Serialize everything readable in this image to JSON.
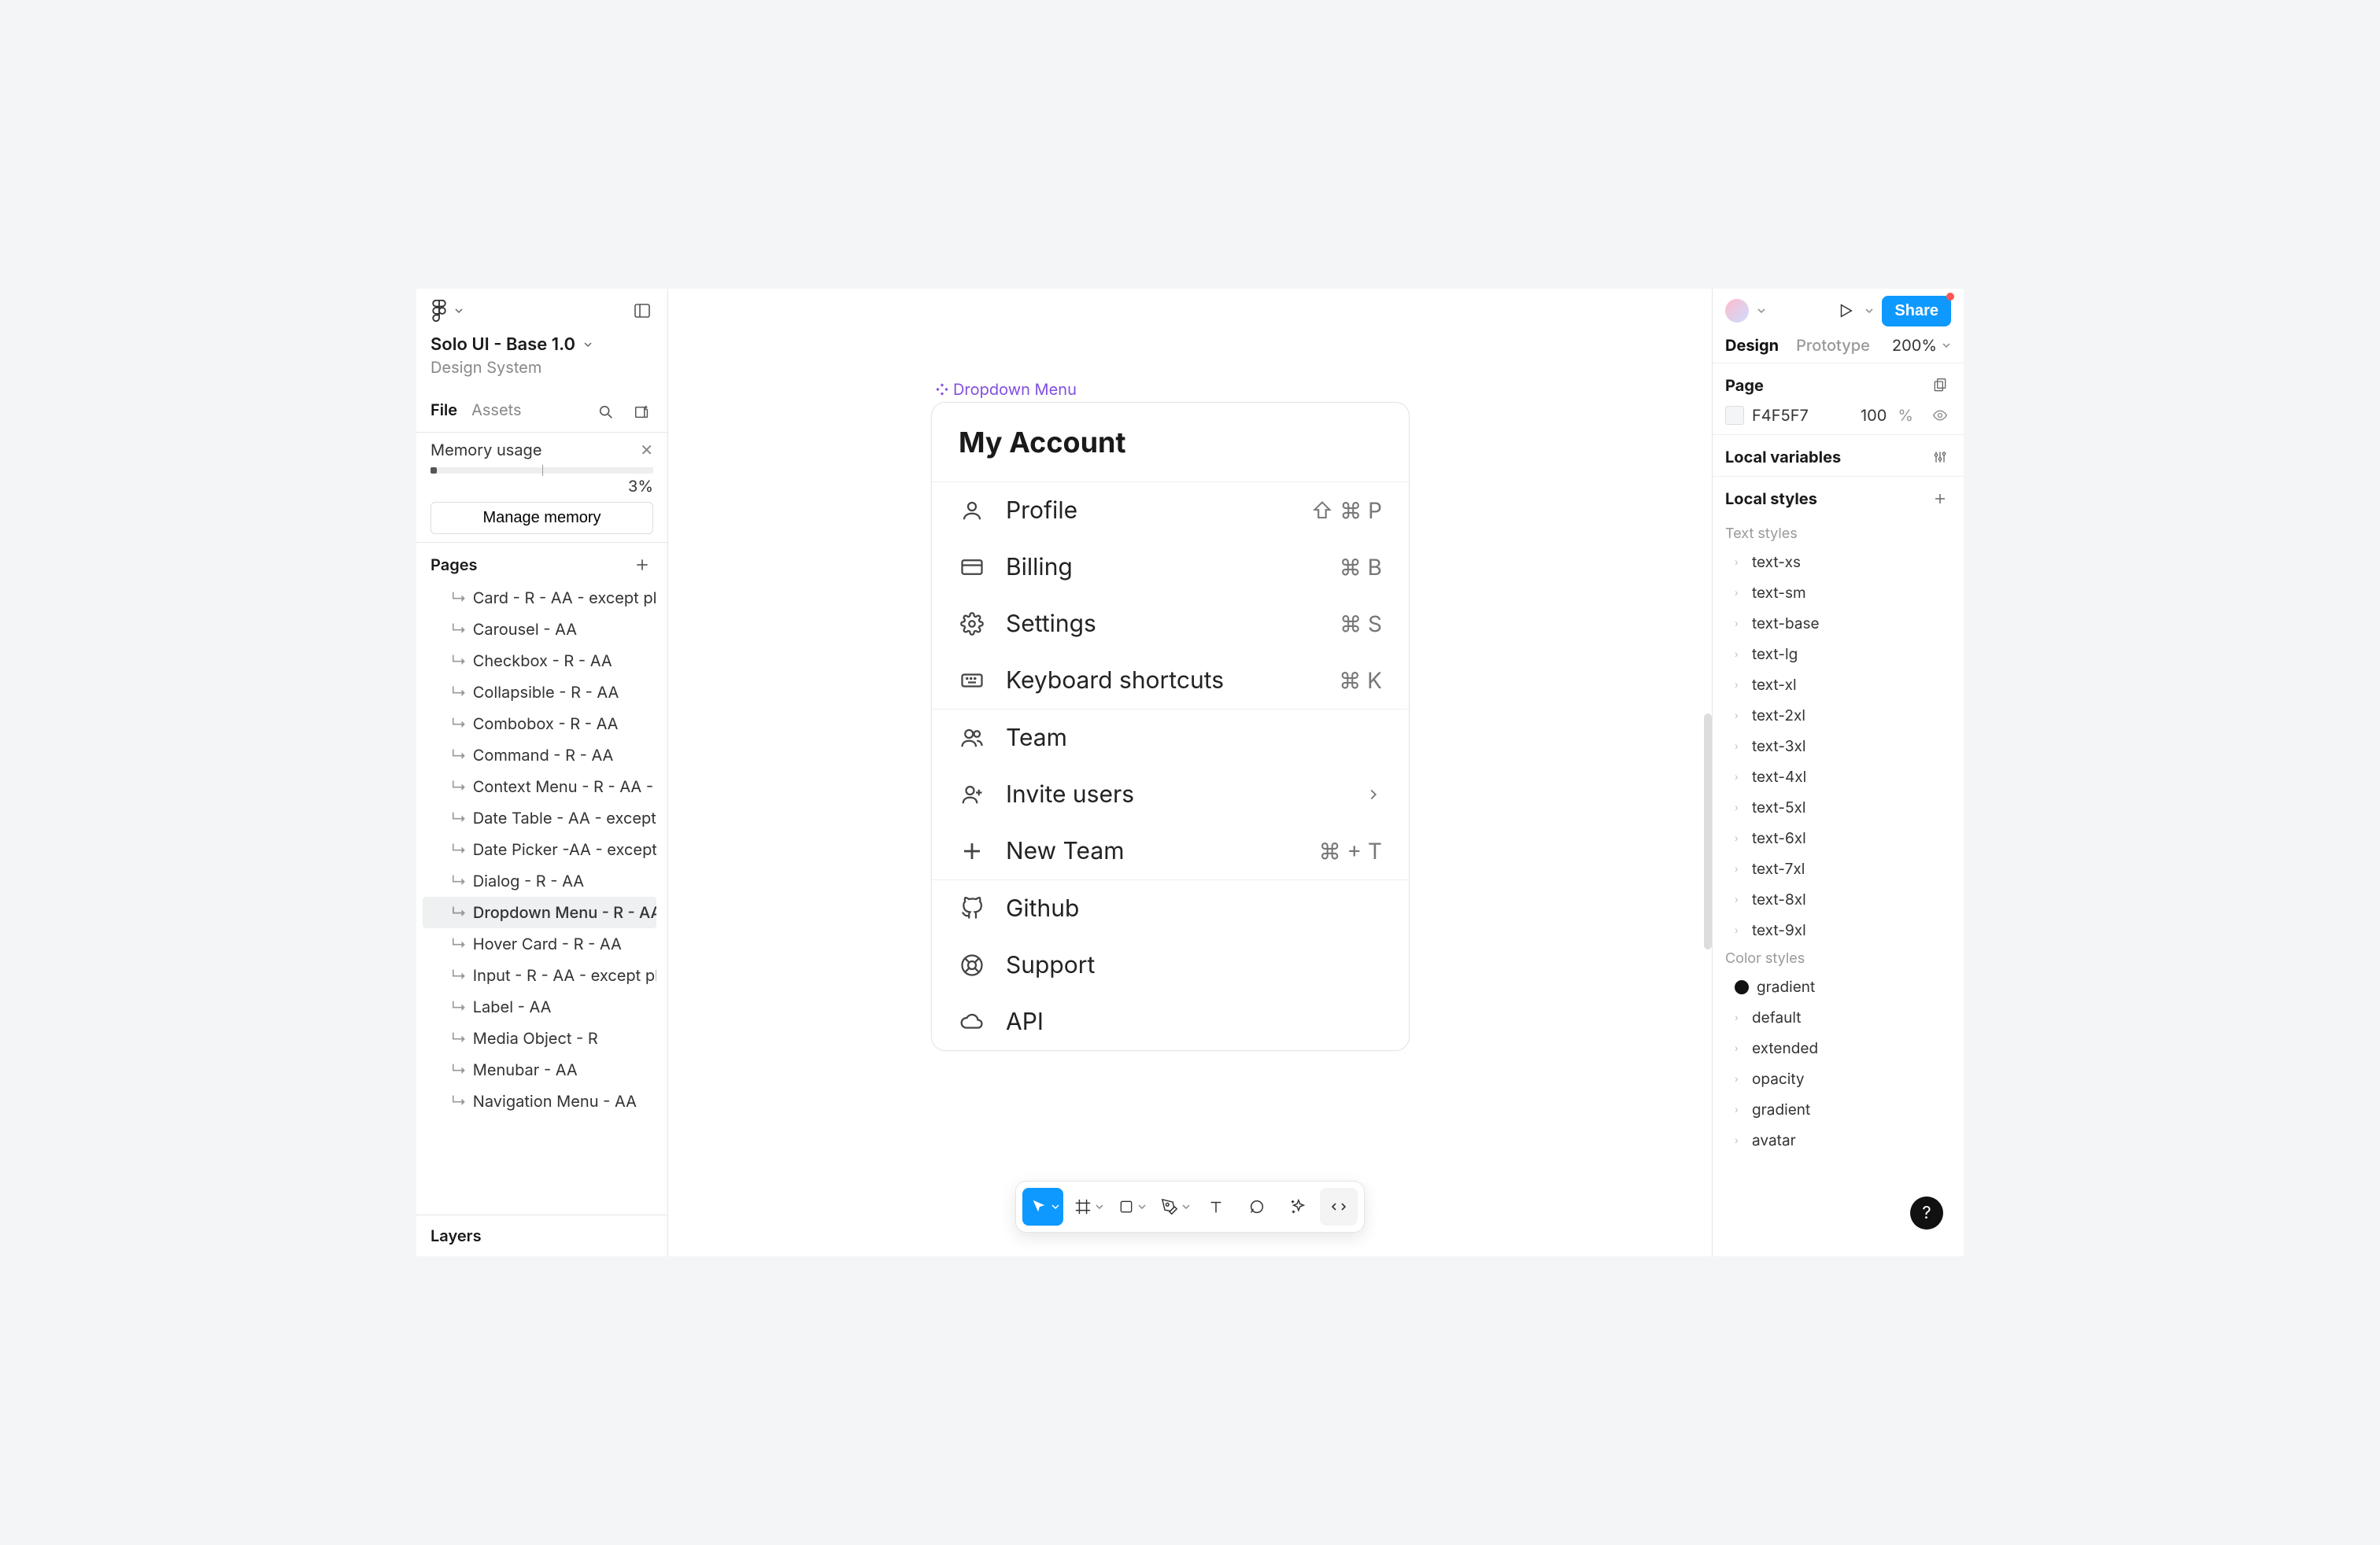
{
  "leftPanel": {
    "file": {
      "title": "Solo UI - Base 1.0",
      "subtitle": "Design System"
    },
    "tabs": {
      "file": "File",
      "assets": "Assets"
    },
    "memory": {
      "heading": "Memory usage",
      "percent": "3%",
      "manage": "Manage memory"
    },
    "pagesHeading": "Pages",
    "pages": [
      "Card - R - AA - except placehol…",
      "Carousel  - AA",
      "Checkbox - R - AA",
      "Collapsible - R - AA",
      "Combobox - R - AA",
      "Command - R - AA",
      "Context Menu - R - AA - except…",
      "Date Table - AA - except placeh…",
      "Date Picker -AA - except disabl…",
      "Dialog - R - AA",
      "Dropdown Menu - R - AA - exc…",
      "Hover Card - R - AA",
      "Input - R - AA - except placehol…",
      "Label - AA",
      "Media Object - R",
      "Menubar - AA",
      "Navigation Menu - AA"
    ],
    "selectedPageIndex": 10,
    "layersHeading": "Layers"
  },
  "canvas": {
    "frameLabel": "Dropdown Menu",
    "menu": {
      "title": "My Account",
      "groups": [
        [
          {
            "icon": "user",
            "label": "Profile",
            "shortcut": "⇧ ⌘ P"
          },
          {
            "icon": "card",
            "label": "Billing",
            "shortcut": "⌘ B"
          },
          {
            "icon": "gear",
            "label": "Settings",
            "shortcut": "⌘ S"
          },
          {
            "icon": "keyboard",
            "label": "Keyboard shortcuts",
            "shortcut": "⌘ K"
          }
        ],
        [
          {
            "icon": "users",
            "label": "Team"
          },
          {
            "icon": "userplus",
            "label": "Invite users",
            "chevron": true
          },
          {
            "icon": "plus",
            "label": "New Team",
            "shortcut": "⌘ + T"
          }
        ],
        [
          {
            "icon": "github",
            "label": "Github"
          },
          {
            "icon": "life",
            "label": "Support"
          },
          {
            "icon": "cloud",
            "label": "API"
          }
        ]
      ]
    }
  },
  "rightPanel": {
    "tabs": {
      "design": "Design",
      "prototype": "Prototype"
    },
    "zoom": "200%",
    "share": "Share",
    "page": {
      "heading": "Page",
      "colorHex": "F4F5F7",
      "colorPct": "100",
      "colorUnit": "%"
    },
    "localVariables": "Local variables",
    "localStyles": "Local styles",
    "textStylesHeading": "Text styles",
    "textStyles": [
      "text-xs",
      "text-sm",
      "text-base",
      "text-lg",
      "text-xl",
      "text-2xl",
      "text-3xl",
      "text-4xl",
      "text-5xl",
      "text-6xl",
      "text-7xl",
      "text-8xl",
      "text-9xl"
    ],
    "colorStylesHeading": "Color styles",
    "colorStyles": [
      {
        "label": "gradient",
        "swatch": true
      },
      {
        "label": "default"
      },
      {
        "label": "extended"
      },
      {
        "label": "opacity"
      },
      {
        "label": "gradient"
      },
      {
        "label": "avatar"
      }
    ]
  },
  "help": "?"
}
